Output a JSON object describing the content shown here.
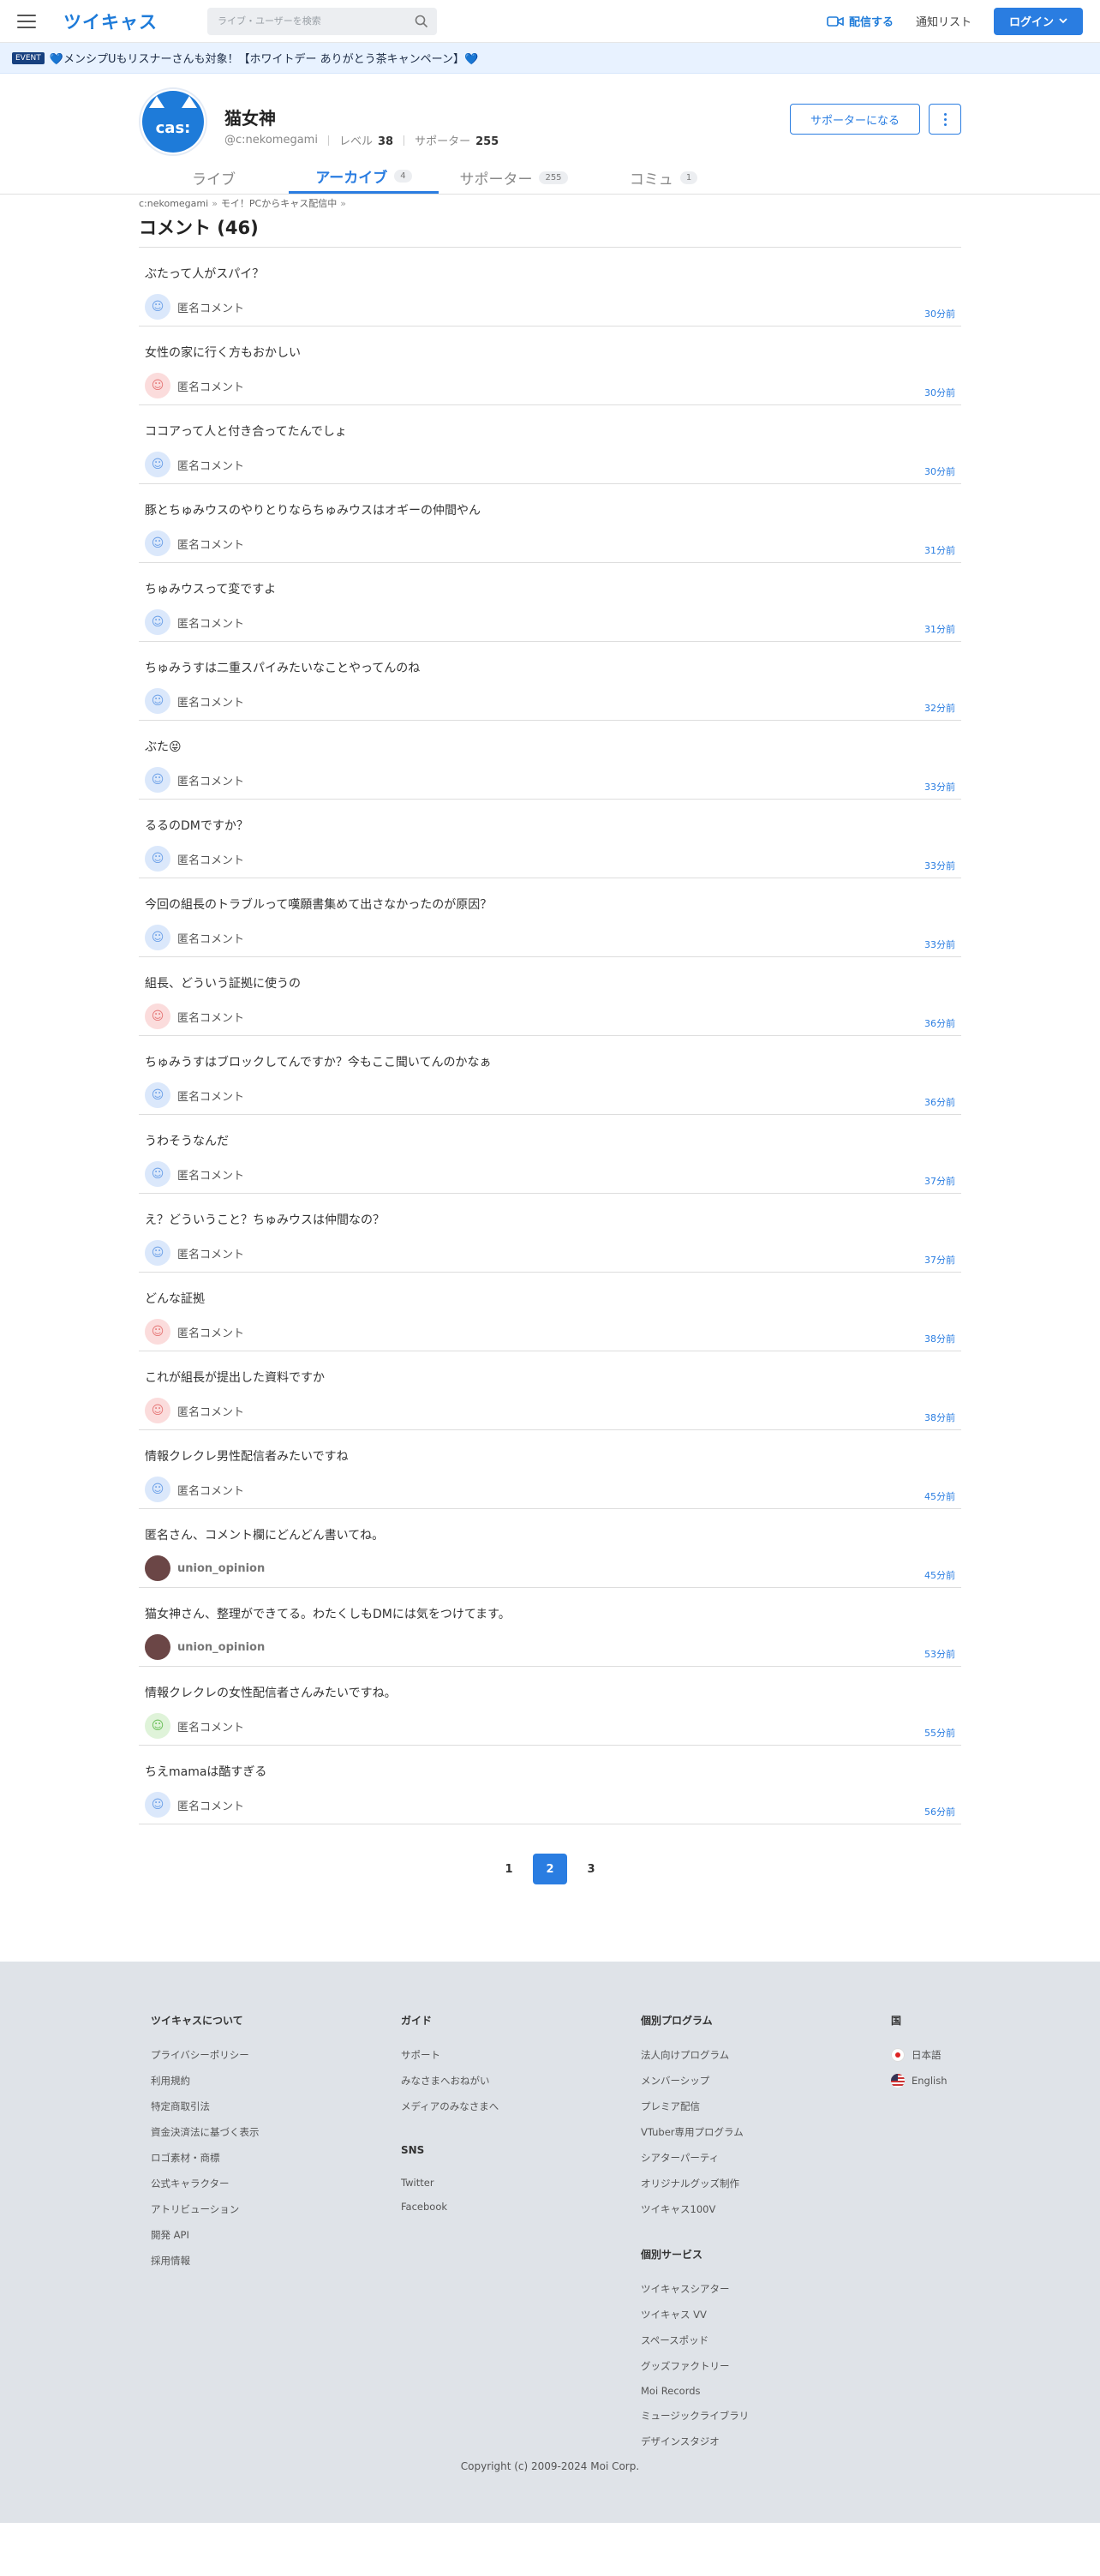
{
  "header": {
    "logo": "ツイキャス",
    "search_placeholder": "ライブ・ユーザーを検索",
    "broadcast_label": "配信する",
    "notification_label": "通知リスト",
    "login_label": "ログイン"
  },
  "event": {
    "tag": "EVENT",
    "text": "💙メンシプUもリスナーさんも対象！【ホワイトデー ありがとう茶キャンペーン】💙"
  },
  "profile": {
    "name": "猫女神",
    "handle": "@c:nekomegami",
    "level_label": "レベル",
    "level": "38",
    "supporter_label": "サポーター",
    "supporter_count": "255",
    "support_button": "サポーターになる",
    "avatar_text": "cas:"
  },
  "tabs": [
    {
      "label": "ライブ",
      "count": ""
    },
    {
      "label": "アーカイブ",
      "count": "4"
    },
    {
      "label": "サポーター",
      "count": "255"
    },
    {
      "label": "コミュ",
      "count": "1"
    }
  ],
  "breadcrumb": {
    "user": "c:nekomegami",
    "sep": "»",
    "movie": "モイ！PCからキャス配信中",
    "sep2": "»"
  },
  "comments_title": "コメント (46)",
  "comments": [
    {
      "text": "ぶたって人がスパイ？",
      "user": "匿名コメント",
      "avatar": "blue",
      "time": "30分前"
    },
    {
      "text": "女性の家に行く方もおかしい",
      "user": "匿名コメント",
      "avatar": "pink",
      "time": "30分前"
    },
    {
      "text": "ココアって人と付き合ってたんでしょ",
      "user": "匿名コメント",
      "avatar": "blue",
      "time": "30分前"
    },
    {
      "text": "豚とちゅみウスのやりとりならちゅみウスはオギーの仲間やん",
      "user": "匿名コメント",
      "avatar": "blue",
      "time": "31分前"
    },
    {
      "text": "ちゅみウスって変ですよ",
      "user": "匿名コメント",
      "avatar": "blue",
      "time": "31分前"
    },
    {
      "text": "ちゅみうすは二重スパイみたいなことやってんのね",
      "user": "匿名コメント",
      "avatar": "blue",
      "time": "32分前"
    },
    {
      "text": "ぶた😝",
      "user": "匿名コメント",
      "avatar": "blue",
      "time": "33分前"
    },
    {
      "text": "るるのDMですか？",
      "user": "匿名コメント",
      "avatar": "blue",
      "time": "33分前"
    },
    {
      "text": "今回の組長のトラブルって嘆願書集めて出さなかったのが原因？",
      "user": "匿名コメント",
      "avatar": "blue",
      "time": "33分前"
    },
    {
      "text": "組長、どういう証拠に使うの",
      "user": "匿名コメント",
      "avatar": "pink",
      "time": "36分前"
    },
    {
      "text": "ちゅみうすはブロックしてんですか？今もここ聞いてんのかなぁ",
      "user": "匿名コメント",
      "avatar": "blue",
      "time": "36分前"
    },
    {
      "text": "うわそうなんだ",
      "user": "匿名コメント",
      "avatar": "blue",
      "time": "37分前"
    },
    {
      "text": "え？どういうこと？ちゅみウスは仲間なの？",
      "user": "匿名コメント",
      "avatar": "blue",
      "time": "37分前"
    },
    {
      "text": "どんな証拠",
      "user": "匿名コメント",
      "avatar": "pink",
      "time": "38分前"
    },
    {
      "text": "これが組長が提出した資料ですか",
      "user": "匿名コメント",
      "avatar": "pink",
      "time": "38分前"
    },
    {
      "text": "情報クレクレ男性配信者みたいですね",
      "user": "匿名コメント",
      "avatar": "blue",
      "time": "45分前"
    },
    {
      "text": "匿名さん、コメント欄にどんどん書いてね。",
      "user": "union_opinion",
      "avatar": "photo",
      "time": "45分前"
    },
    {
      "text": "猫女神さん、整理ができてる。わたくしもDMには気をつけてます。",
      "user": "union_opinion",
      "avatar": "photo",
      "time": "53分前"
    },
    {
      "text": "情報クレクレの女性配信者さんみたいですね。",
      "user": "匿名コメント",
      "avatar": "green",
      "time": "55分前"
    },
    {
      "text": "ちえmamaは酷すぎる",
      "user": "匿名コメント",
      "avatar": "blue",
      "time": "56分前"
    }
  ],
  "pagination": [
    "1",
    "2",
    "3"
  ],
  "pagination_active": "2",
  "footer": {
    "about_title": "ツイキャスについて",
    "about": [
      "プライバシーポリシー",
      "利用規約",
      "特定商取引法",
      "資金決済法に基づく表示",
      "ロゴ素材・商標",
      "公式キャラクター",
      "アトリビューション",
      "開発 API",
      "採用情報"
    ],
    "guide_title": "ガイド",
    "guide": [
      "サポート",
      "みなさまへおねがい",
      "メディアのみなさまへ"
    ],
    "sns_title": "SNS",
    "sns": [
      "Twitter",
      "Facebook"
    ],
    "program_title": "個別プログラム",
    "program": [
      "法人向けプログラム",
      "メンバーシップ",
      "プレミア配信",
      "VTuber専用プログラム",
      "シアターパーティ",
      "オリジナルグッズ制作",
      "ツイキャス100V"
    ],
    "service_title": "個別サービス",
    "service": [
      "ツイキャスシアター",
      "ツイキャス VV",
      "スペースポッド",
      "グッズファクトリー",
      "Moi Records",
      "ミュージックライブラリ",
      "デザインスタジオ"
    ],
    "country_title": "国",
    "countries": [
      "日本語",
      "English"
    ],
    "copyright": "Copyright (c) 2009-2024 Moi Corp."
  }
}
